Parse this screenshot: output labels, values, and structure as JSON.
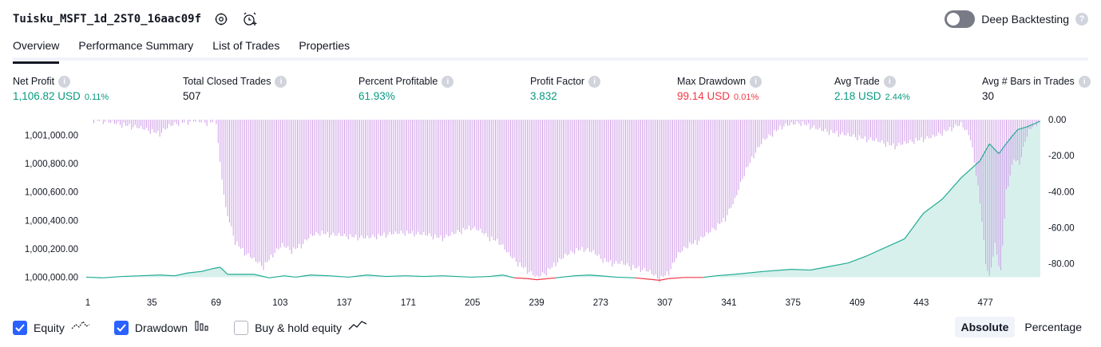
{
  "header": {
    "title": "Tuisku_MSFT_1d_2ST0_16aac09f",
    "icons": [
      "settings-icon",
      "add-alert-icon"
    ]
  },
  "deep_backtesting": {
    "label": "Deep Backtesting",
    "enabled": false,
    "help_icon": "question-icon"
  },
  "tabs": [
    {
      "label": "Overview",
      "active": true
    },
    {
      "label": "Performance Summary",
      "active": false
    },
    {
      "label": "List of Trades",
      "active": false
    },
    {
      "label": "Properties",
      "active": false
    }
  ],
  "stats": [
    {
      "label": "Net Profit",
      "value": "1,106.82 USD",
      "pct": "0.11%",
      "color": "#089981"
    },
    {
      "label": "Total Closed Trades",
      "value": "507",
      "pct": "",
      "color": "#131722"
    },
    {
      "label": "Percent Profitable",
      "value": "61.93%",
      "pct": "",
      "color": "#089981"
    },
    {
      "label": "Profit Factor",
      "value": "3.832",
      "pct": "",
      "color": "#089981"
    },
    {
      "label": "Max Drawdown",
      "value": "99.14 USD",
      "pct": "0.01%",
      "color": "#f23645"
    },
    {
      "label": "Avg Trade",
      "value": "2.18 USD",
      "pct": "2.44%",
      "color": "#089981"
    },
    {
      "label": "Avg # Bars in Trades",
      "value": "30",
      "pct": "",
      "color": "#131722"
    }
  ],
  "chart_data": {
    "type": "area",
    "x_ticks": [
      "1",
      "35",
      "69",
      "103",
      "137",
      "171",
      "205",
      "239",
      "273",
      "307",
      "341",
      "375",
      "409",
      "443",
      "477"
    ],
    "xlim": [
      1,
      507
    ],
    "left_axis": {
      "ticks": [
        "1,000,000.00",
        "1,000,200.00",
        "1,000,400.00",
        "1,000,600.00",
        "1,000,800.00",
        "1,001,000.00"
      ],
      "ylim": [
        999980,
        1001110
      ]
    },
    "right_axis": {
      "ticks": [
        "0.00",
        "-20.00",
        "-40.00",
        "-60.00",
        "-80.00"
      ],
      "ylim": [
        -89,
        0
      ]
    },
    "colors": {
      "equity_up": "#22ab94",
      "equity_down": "#f23645",
      "fill": "#22ab94",
      "drawdown": "#cf9ee8"
    },
    "series": [
      {
        "name": "Equity",
        "points": [
          [
            1,
            1000000
          ],
          [
            10,
            999995
          ],
          [
            20,
            1000005
          ],
          [
            30,
            1000010
          ],
          [
            40,
            1000015
          ],
          [
            48,
            1000010
          ],
          [
            55,
            1000030
          ],
          [
            62,
            1000040
          ],
          [
            68,
            1000060
          ],
          [
            72,
            1000070
          ],
          [
            76,
            1000020
          ],
          [
            90,
            1000020
          ],
          [
            98,
            999995
          ],
          [
            106,
            1000010
          ],
          [
            112,
            1000000
          ],
          [
            120,
            1000015
          ],
          [
            130,
            1000010
          ],
          [
            140,
            1000000
          ],
          [
            150,
            1000015
          ],
          [
            160,
            1000005
          ],
          [
            170,
            1000010
          ],
          [
            180,
            1000005
          ],
          [
            190,
            1000010
          ],
          [
            205,
            1000000
          ],
          [
            215,
            1000005
          ],
          [
            222,
            1000015
          ],
          [
            228,
            999995
          ],
          [
            235,
            999990
          ],
          [
            240,
            999982
          ],
          [
            250,
            999995
          ],
          [
            260,
            1000010
          ],
          [
            268,
            1000015
          ],
          [
            275,
            1000008
          ],
          [
            282,
            1000000
          ],
          [
            292,
            999995
          ],
          [
            300,
            999985
          ],
          [
            305,
            999978
          ],
          [
            310,
            999990
          ],
          [
            318,
            999998
          ],
          [
            328,
            999998
          ],
          [
            335,
            1000010
          ],
          [
            345,
            1000020
          ],
          [
            360,
            1000040
          ],
          [
            375,
            1000055
          ],
          [
            385,
            1000050
          ],
          [
            395,
            1000075
          ],
          [
            405,
            1000100
          ],
          [
            415,
            1000150
          ],
          [
            425,
            1000210
          ],
          [
            435,
            1000270
          ],
          [
            445,
            1000450
          ],
          [
            455,
            1000550
          ],
          [
            465,
            1000700
          ],
          [
            475,
            1000820
          ],
          [
            480,
            1000940
          ],
          [
            485,
            1000870
          ],
          [
            490,
            1000960
          ],
          [
            495,
            1001040
          ],
          [
            500,
            1001060
          ],
          [
            507,
            1001100
          ]
        ]
      },
      {
        "name": "Drawdown",
        "points": [
          [
            1,
            0
          ],
          [
            10,
            -1
          ],
          [
            20,
            -3
          ],
          [
            30,
            -5
          ],
          [
            40,
            -8
          ],
          [
            45,
            -4
          ],
          [
            50,
            -2
          ],
          [
            58,
            -1
          ],
          [
            65,
            -2
          ],
          [
            70,
            -1
          ],
          [
            72,
            -25
          ],
          [
            75,
            -50
          ],
          [
            80,
            -68
          ],
          [
            85,
            -74
          ],
          [
            90,
            -78
          ],
          [
            95,
            -82
          ],
          [
            100,
            -75
          ],
          [
            105,
            -70
          ],
          [
            110,
            -73
          ],
          [
            115,
            -70
          ],
          [
            120,
            -65
          ],
          [
            125,
            -63
          ],
          [
            130,
            -64
          ],
          [
            140,
            -65
          ],
          [
            150,
            -66
          ],
          [
            160,
            -64
          ],
          [
            170,
            -63
          ],
          [
            180,
            -64
          ],
          [
            190,
            -66
          ],
          [
            200,
            -62
          ],
          [
            205,
            -60
          ],
          [
            210,
            -62
          ],
          [
            215,
            -66
          ],
          [
            220,
            -68
          ],
          [
            225,
            -75
          ],
          [
            230,
            -80
          ],
          [
            235,
            -84
          ],
          [
            240,
            -88
          ],
          [
            245,
            -85
          ],
          [
            250,
            -80
          ],
          [
            255,
            -76
          ],
          [
            260,
            -73
          ],
          [
            265,
            -72
          ],
          [
            270,
            -74
          ],
          [
            275,
            -78
          ],
          [
            280,
            -80
          ],
          [
            285,
            -80
          ],
          [
            290,
            -82
          ],
          [
            295,
            -83
          ],
          [
            300,
            -85
          ],
          [
            305,
            -89
          ],
          [
            310,
            -85
          ],
          [
            315,
            -75
          ],
          [
            320,
            -70
          ],
          [
            325,
            -68
          ],
          [
            330,
            -64
          ],
          [
            335,
            -60
          ],
          [
            340,
            -55
          ],
          [
            345,
            -45
          ],
          [
            350,
            -30
          ],
          [
            355,
            -20
          ],
          [
            360,
            -12
          ],
          [
            370,
            -4
          ],
          [
            380,
            -2
          ],
          [
            390,
            -6
          ],
          [
            400,
            -8
          ],
          [
            410,
            -10
          ],
          [
            420,
            -12
          ],
          [
            430,
            -15
          ],
          [
            440,
            -12
          ],
          [
            450,
            -10
          ],
          [
            460,
            -5
          ],
          [
            465,
            -3
          ],
          [
            470,
            -10
          ],
          [
            475,
            -45
          ],
          [
            478,
            -80
          ],
          [
            480,
            -88
          ],
          [
            483,
            -70
          ],
          [
            486,
            -85
          ],
          [
            489,
            -40
          ],
          [
            493,
            -22
          ],
          [
            496,
            -25
          ],
          [
            500,
            -8
          ],
          [
            503,
            -4
          ],
          [
            507,
            0
          ]
        ]
      }
    ]
  },
  "legend": [
    {
      "label": "Equity",
      "checked": true,
      "icon": "equity-line-icon"
    },
    {
      "label": "Drawdown",
      "checked": true,
      "icon": "drawdown-bars-icon"
    },
    {
      "label": "Buy & hold equity",
      "checked": false,
      "icon": "buy-hold-line-icon"
    }
  ],
  "scale_buttons": [
    {
      "label": "Absolute",
      "active": true
    },
    {
      "label": "Percentage",
      "active": false
    }
  ]
}
